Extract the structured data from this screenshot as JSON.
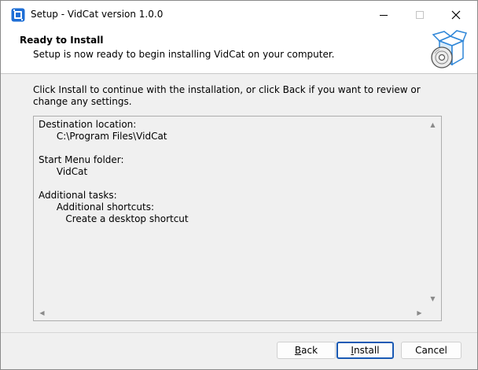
{
  "window": {
    "title": "Setup - VidCat version 1.0.0",
    "controls": {
      "minimize": "minimize-icon",
      "maximize": "maximize-icon",
      "close": "close-icon"
    }
  },
  "header": {
    "title": "Ready to Install",
    "subtitle": "Setup is now ready to begin installing VidCat on your computer."
  },
  "main": {
    "instruction": "Click Install to continue with the installation, or click Back if you want to review or change any settings.",
    "summary": [
      "Destination location:",
      "      C:\\Program Files\\VidCat",
      "",
      "Start Menu folder:",
      "      VidCat",
      "",
      "Additional tasks:",
      "      Additional shortcuts:",
      "         Create a desktop shortcut"
    ]
  },
  "buttons": {
    "back_label": "Back",
    "back_accesskey": "B",
    "install_label": "Install",
    "install_accesskey": "I",
    "cancel_label": "Cancel"
  },
  "colors": {
    "accent": "#1a5ab4",
    "app_icon": "#1f6fd6",
    "title_bg": "#ffffff",
    "body_bg": "#f0f0f0"
  }
}
